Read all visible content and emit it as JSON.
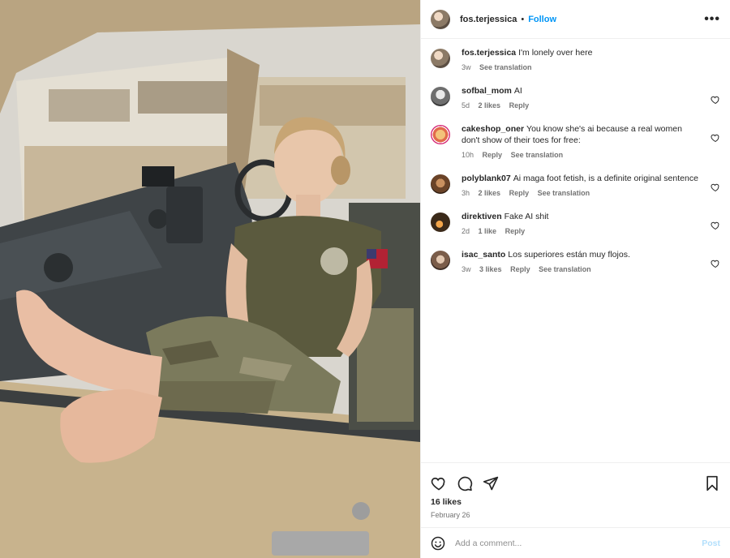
{
  "post": {
    "author": "fos.terjessica",
    "separator": "•",
    "follow_label": "Follow",
    "more_icon": "more-horizontal-icon",
    "caption": {
      "user": "fos.terjessica",
      "text": "I'm lonely over here",
      "time": "3w",
      "see_translation": "See translation"
    },
    "comments": [
      {
        "user": "sofbal_mom",
        "text": "AI",
        "time": "5d",
        "likes": "2 likes",
        "reply": "Reply",
        "translation": ""
      },
      {
        "user": "cakeshop_oner",
        "text": "You know she's ai because a real women don't show of their toes for free:",
        "time": "10h",
        "likes": "",
        "reply": "Reply",
        "translation": "See translation"
      },
      {
        "user": "polyblank07",
        "text": "Ai maga foot fetish, is a definite original sentence",
        "time": "3h",
        "likes": "2 likes",
        "reply": "Reply",
        "translation": "See translation"
      },
      {
        "user": "direktiven",
        "text": "Fake AI shit",
        "time": "2d",
        "likes": "1 like",
        "reply": "Reply",
        "translation": ""
      },
      {
        "user": "isac_santo",
        "text": "Los superiores están muy flojos.",
        "time": "3w",
        "likes": "3 likes",
        "reply": "Reply",
        "translation": "See translation"
      }
    ],
    "likes_count": "16 likes",
    "date": "February 26",
    "add_comment_placeholder": "Add a comment...",
    "post_label": "Post",
    "colors": {
      "follow": "#0095f6",
      "post_disabled": "#b2dffc",
      "meta": "#737373",
      "text": "#262626"
    },
    "icons": [
      "heart-icon",
      "comment-icon",
      "share-icon",
      "bookmark-icon",
      "emoji-icon"
    ]
  }
}
